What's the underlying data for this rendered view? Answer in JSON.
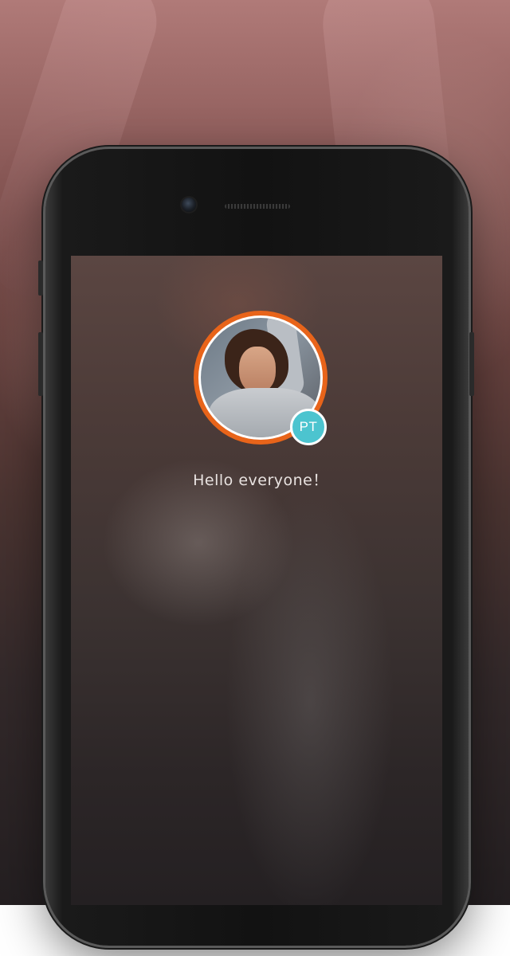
{
  "greeting": "Hello everyone！",
  "badge": "PT",
  "colors": {
    "avatar_ring": "#e8641a",
    "badge_bg": "#4cc4cf"
  },
  "icons": [
    "camera-icon",
    "speaker-grille"
  ]
}
